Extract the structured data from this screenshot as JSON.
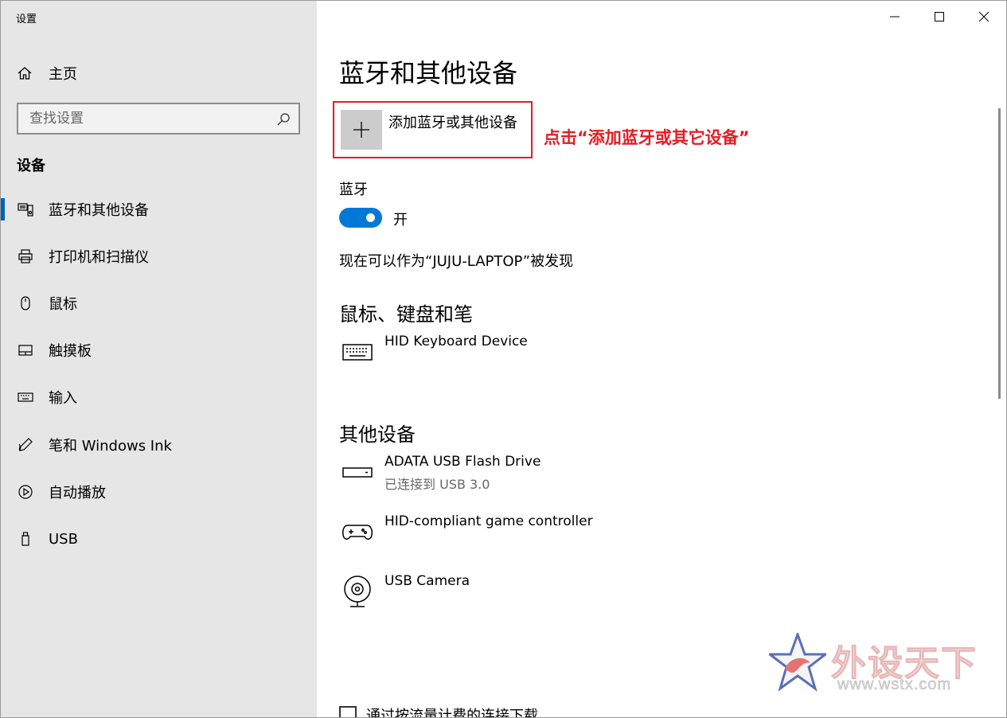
{
  "window": {
    "title": "设置"
  },
  "sidebar": {
    "home_label": "主页",
    "search_placeholder": "查找设置",
    "section_title": "设备",
    "items": [
      {
        "label": "蓝牙和其他设备",
        "icon": "bluetooth-devices-icon",
        "active": true
      },
      {
        "label": "打印机和扫描仪",
        "icon": "printer-icon"
      },
      {
        "label": "鼠标",
        "icon": "mouse-icon"
      },
      {
        "label": "触摸板",
        "icon": "touchpad-icon"
      },
      {
        "label": "输入",
        "icon": "keyboard-icon"
      },
      {
        "label": "笔和 Windows Ink",
        "icon": "pen-icon"
      },
      {
        "label": "自动播放",
        "icon": "autoplay-icon"
      },
      {
        "label": "USB",
        "icon": "usb-icon"
      }
    ]
  },
  "main": {
    "title": "蓝牙和其他设备",
    "add_device_label": "添加蓝牙或其他设备",
    "annotation": "点击“添加蓝牙或其它设备”",
    "bluetooth_label": "蓝牙",
    "bluetooth_state": "开",
    "bluetooth_on": true,
    "discoverable_text": "现在可以作为“JUJU-LAPTOP”被发现",
    "groups": [
      {
        "title": "鼠标、键盘和笔",
        "devices": [
          {
            "name": "HID Keyboard Device",
            "icon": "keyboard-device-icon"
          }
        ]
      },
      {
        "title": "其他设备",
        "devices": [
          {
            "name": "ADATA USB Flash Drive",
            "status": "已连接到 USB 3.0",
            "icon": "flash-drive-icon"
          },
          {
            "name": "HID-compliant game controller",
            "icon": "gamepad-icon"
          },
          {
            "name": "USB Camera",
            "icon": "camera-icon"
          }
        ]
      }
    ],
    "metered_checkbox_label": "通过按流量计费的连接下载"
  },
  "watermark": {
    "text": "外设天下",
    "url": "www.wstx.com"
  },
  "colors": {
    "accent": "#0078d7",
    "annotation": "#e51c23",
    "sidebar_bg": "#e6e6e6"
  }
}
